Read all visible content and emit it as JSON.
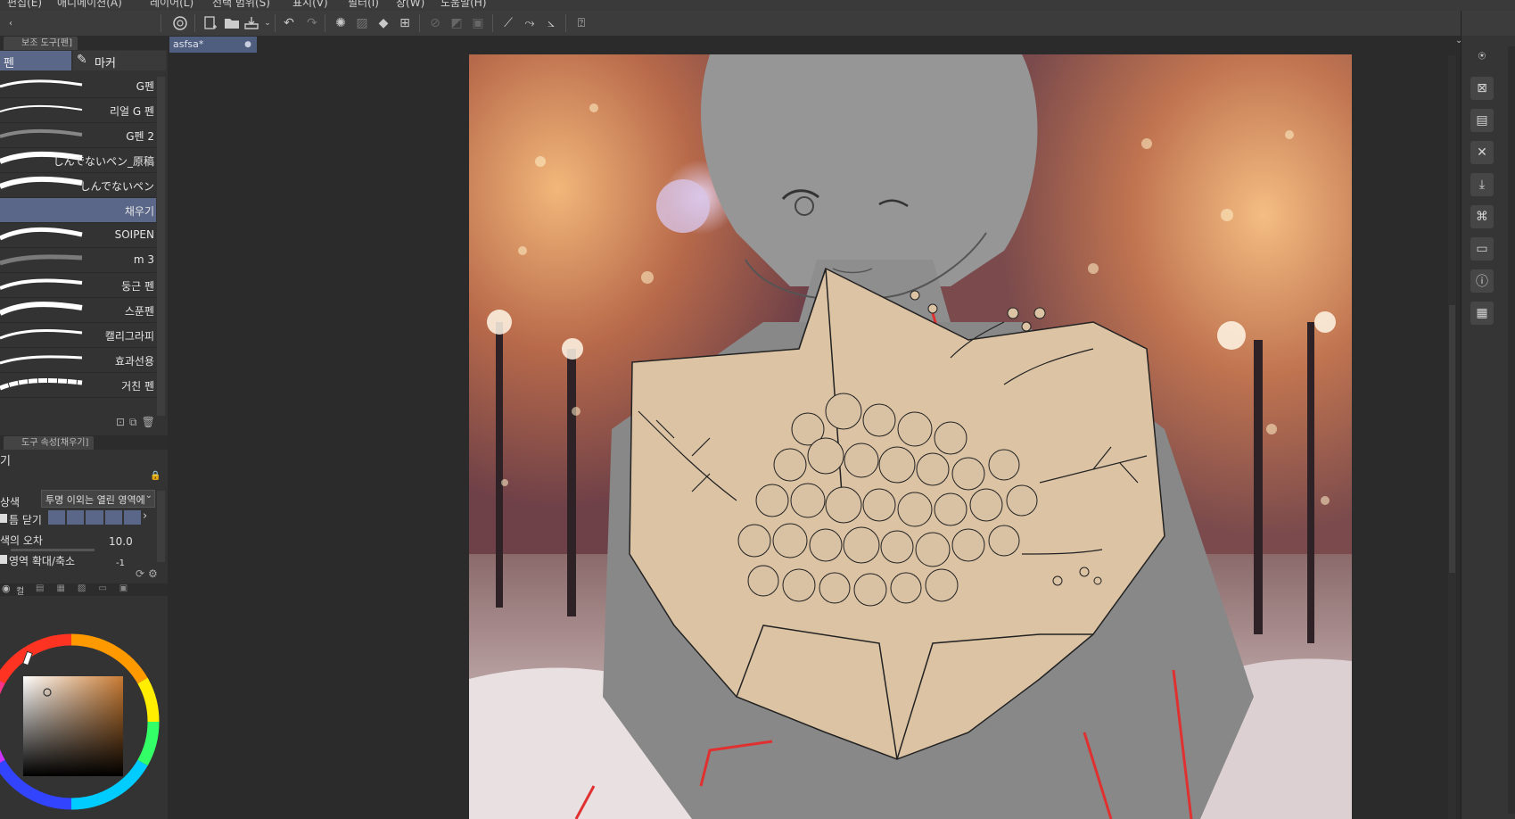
{
  "menu": [
    "편집(E)",
    "애니메이션(A)",
    "레이어(L)",
    "선택 범위(S)",
    "표시(V)",
    "필터(I)",
    "창(W)",
    "도움말(H)"
  ],
  "document": {
    "tab_name": "asfsa*"
  },
  "subtool_panel": {
    "title": "보조 도구[펜]",
    "tabs": [
      "펜",
      "마커"
    ],
    "brushes": [
      "G펜",
      "리얼 G 펜",
      "G펜 2",
      "しんでないペン_原稿",
      "しんでないペン",
      "채우기",
      "SOIPEN",
      "m 3",
      "둥근 펜",
      "스푼펜",
      "캘리그라피",
      "효과선용",
      "거친 펜"
    ],
    "selected_index": 5
  },
  "tool_property": {
    "title": "도구 속성[채우기]",
    "tool_name": "기",
    "target_label": "상색",
    "target_value": "투명 이외는 열린 영역에",
    "close_gap_label": "틈 닫기",
    "tolerance_label": "색의 오차",
    "tolerance_value": "10.0",
    "expand_label": "영역 확대/축소",
    "expand_value": "-1"
  },
  "color_panel": {
    "tab_label": "컬",
    "current_color": "#c87a32"
  },
  "icons": {
    "toolbar": [
      "lasso-icon",
      "new-icon",
      "open-icon",
      "save-icon",
      "undo-icon",
      "redo-icon",
      "brush-settings-icon",
      "select-icon",
      "fill-icon",
      "transform-icon"
    ],
    "right": [
      "navigator-icon",
      "close-panel-icon",
      "layer-icon",
      "close-icon",
      "import-icon",
      "camera-icon",
      "folder-icon",
      "info-icon",
      "grid-icon"
    ]
  },
  "colors": {
    "accent": "#5a6788",
    "panel": "#333333",
    "canvas_bg": "#2b2b2b"
  }
}
